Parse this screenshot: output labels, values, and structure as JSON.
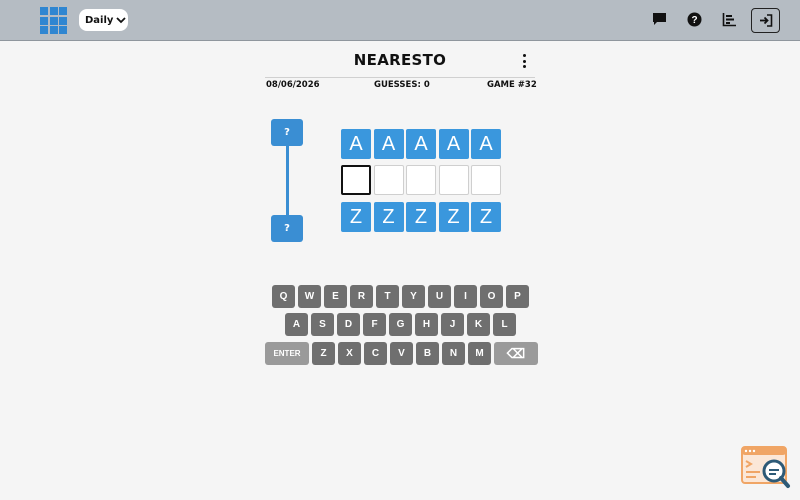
{
  "header": {
    "mode_label": "Daily",
    "icons": [
      "logo-grid-icon",
      "chat-icon",
      "help-icon",
      "stats-icon",
      "login-icon"
    ]
  },
  "game": {
    "title": "NEARESTO",
    "date": "08/06/2026",
    "guesses": "GUESSES: 0",
    "game_number": "GAME #32",
    "hints": [
      "?",
      "?"
    ]
  },
  "board": {
    "top_row": [
      "A",
      "A",
      "A",
      "A",
      "A"
    ],
    "input_row": [
      "",
      "",
      "",
      "",
      ""
    ],
    "bottom_row": [
      "Z",
      "Z",
      "Z",
      "Z",
      "Z"
    ],
    "active_index": 0
  },
  "keyboard": {
    "row1": [
      "Q",
      "W",
      "E",
      "R",
      "T",
      "Y",
      "U",
      "I",
      "O",
      "P"
    ],
    "row2": [
      "A",
      "S",
      "D",
      "F",
      "G",
      "H",
      "J",
      "K",
      "L"
    ],
    "row3": [
      "Z",
      "X",
      "C",
      "V",
      "B",
      "N",
      "M"
    ],
    "enter_label": "ENTER",
    "backspace_label": "⌫"
  },
  "colors": {
    "accent": "#3a97dd",
    "key": "#6f6f6f",
    "topbar": "#b5bcc3"
  }
}
